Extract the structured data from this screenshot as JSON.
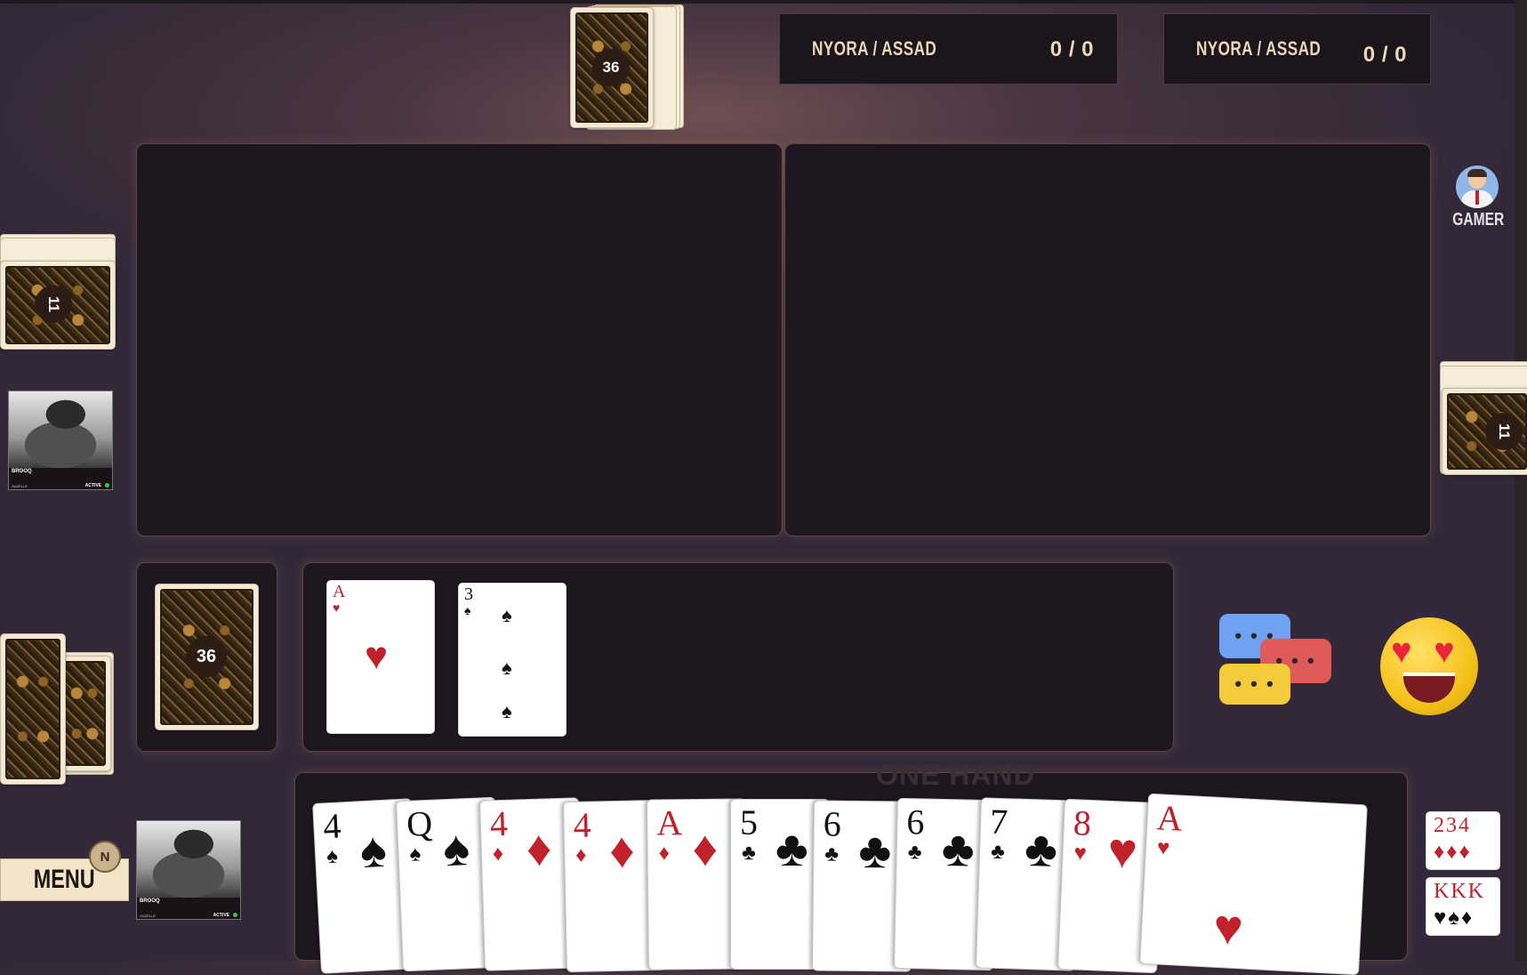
{
  "scoreboards": [
    {
      "names": "NYORA / ASSAD",
      "points": "0 / 0"
    },
    {
      "names": "NYORA / ASSAD",
      "points": "0 / 0"
    }
  ],
  "deck": {
    "top_count": "36",
    "bottom_count": "36"
  },
  "side_decks": {
    "left_count": "11",
    "right_count": "11"
  },
  "players": {
    "left": {
      "name": "BROOQ",
      "subtitle": "GAZELLE",
      "status": "ACTIVE"
    },
    "bottom": {
      "name": "BROOQ",
      "subtitle": "GAZELLE",
      "status": "ACTIVE"
    },
    "gamer": {
      "label": "GAMER"
    }
  },
  "menu": {
    "label": "MENU",
    "badge": "N"
  },
  "played_cards": [
    {
      "rank": "A",
      "suit": "♥",
      "color": "red"
    },
    {
      "rank": "3",
      "suit": "♠",
      "color": "black"
    }
  ],
  "hand_area_label": "ONE HAND",
  "hand": [
    {
      "rank": "4",
      "suit": "♠",
      "color": "black"
    },
    {
      "rank": "Q",
      "suit": "♠",
      "color": "black"
    },
    {
      "rank": "4",
      "suit": "♦",
      "color": "red"
    },
    {
      "rank": "4",
      "suit": "♦",
      "color": "red"
    },
    {
      "rank": "A",
      "suit": "♦",
      "color": "red"
    },
    {
      "rank": "5",
      "suit": "♣",
      "color": "black"
    },
    {
      "rank": "6",
      "suit": "♣",
      "color": "black"
    },
    {
      "rank": "6",
      "suit": "♣",
      "color": "black"
    },
    {
      "rank": "7",
      "suit": "♣",
      "color": "black"
    },
    {
      "rank": "8",
      "suit": "♥",
      "color": "red"
    },
    {
      "rank": "A",
      "suit": "♥",
      "color": "red"
    }
  ],
  "sort_buttons": [
    {
      "ranks": "2 3 4",
      "suits": "♦♦♦"
    },
    {
      "ranks": "K K K",
      "suits": "♥♠♦"
    }
  ],
  "colors": {
    "accent": "#ecd8b8",
    "panel": "#1f1720",
    "background": "#3a2c3a"
  }
}
